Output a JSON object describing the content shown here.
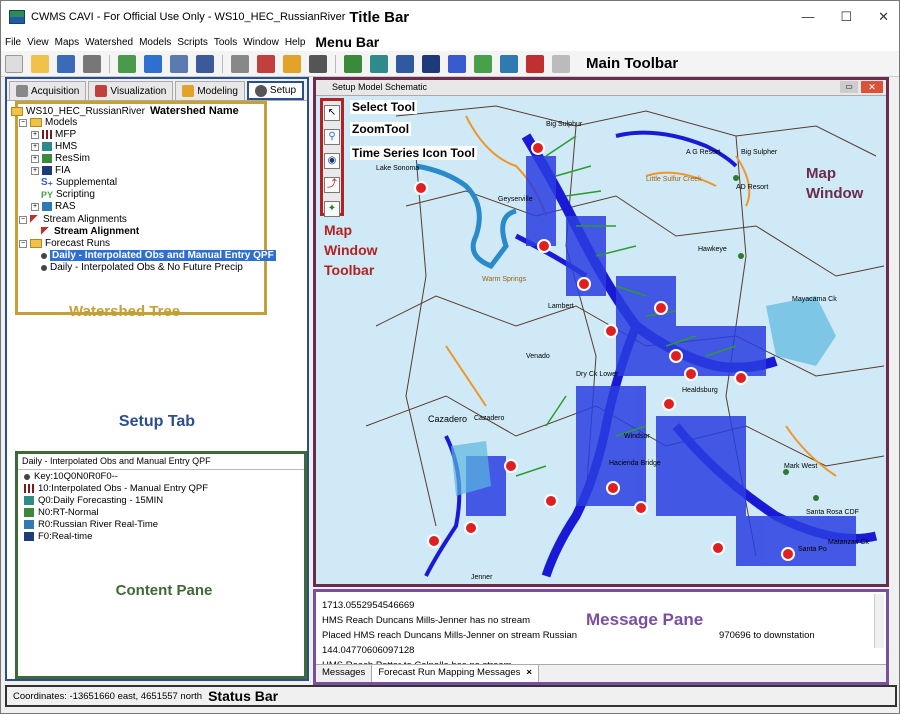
{
  "titlebar": {
    "title": "CWMS CAVI - For Official Use Only  - WS10_HEC_RussianRiver",
    "callout": "Title Bar",
    "minimize": "—",
    "maximize": "☐",
    "close": "✕"
  },
  "menubar": {
    "items": [
      "File",
      "View",
      "Maps",
      "Watershed",
      "Models",
      "Scripts",
      "Tools",
      "Window",
      "Help"
    ],
    "callout": "Menu Bar"
  },
  "toolbar": {
    "callout": "Main Toolbar"
  },
  "tabs": [
    "Acquisition",
    "Visualization",
    "Modeling",
    "Setup"
  ],
  "tree": {
    "watershed": "WS10_HEC_RussianRiver",
    "watershed_callout": "Watershed Name",
    "models": "Models",
    "model_items": [
      "MFP",
      "HMS",
      "ResSim",
      "FIA",
      "Supplemental",
      "Scripting",
      "RAS"
    ],
    "stream_alignments": "Stream Alignments",
    "stream_alignment": "Stream Alignment",
    "forecast_runs": "Forecast Runs",
    "runs": [
      "Daily - Interpolated Obs and Manual Entry QPF",
      "Daily - Interpolated Obs & No Future Precip"
    ],
    "callout": "Watershed Tree"
  },
  "setup_callout": "Setup Tab",
  "content": {
    "header": "Daily - Interpolated Obs and Manual Entry QPF",
    "lines": [
      "Key:10Q0N0R0F0--",
      "10:Interpolated Obs - Manual Entry QPF",
      "Q0:Daily Forecasting - 15MIN",
      "N0:RT-Normal",
      "R0:Russian River Real-Time",
      "F0:Real-time"
    ],
    "callout": "Content Pane"
  },
  "map": {
    "title": "Setup Model Schematic",
    "close": "✕",
    "callouts": {
      "select": "Select Tool",
      "zoom": "ZoomTool",
      "ts": "Time Series Icon Tool",
      "toolbar1": "Map",
      "toolbar2": "Window",
      "toolbar3": "Toolbar",
      "win1": "Map",
      "win2": "Window"
    },
    "places": {
      "bigsulphur": "Big Sulphur",
      "agresort": "A G Resort",
      "bigsulpher2": "Big Sulpher",
      "adresort": "AD Resort",
      "little": "Little Sulfur Creek",
      "geyserville": "Geyserville",
      "hawkeye": "Hawkeye",
      "mayacama": "Mayacama Ck",
      "lambert": "Lambert",
      "warmsprings": "Warm Springs",
      "venado": "Venado",
      "drycklower": "Dry Ck Lower",
      "healdsburg": "Healdsburg",
      "cazadero1": "Cazadero",
      "cazadero2": "Cazadero",
      "windsor": "Windsor",
      "hacienda": "Hacienda Bridge",
      "markwest": "Mark West",
      "santarosa": "Santa Rosa CDF",
      "matanzas": "Matanzas Ck",
      "santapo": "Santa Po",
      "jenner": "Jenner",
      "lakesonoma": "Lake Sonoma"
    }
  },
  "messages": {
    "lines": [
      "1713.0552954546669",
      "HMS Reach Duncans Mills-Jenner has no stream",
      "Placed HMS reach Duncans Mills-Jenner on stream Russian",
      "144.04770606097128",
      "HMS Reach Potter to Calpella has no stream"
    ],
    "line3_tail": "970696 to downstation",
    "callout": "Message Pane",
    "tabs": [
      "Messages",
      "Forecast Run Mapping Messages"
    ],
    "tab_close": "×"
  },
  "status": {
    "coords": "Coordinates: -13651660 east, 4651557 north",
    "callout": "Status Bar"
  },
  "colors": {
    "land": "#cfeaf6",
    "river": "#1a1ad6",
    "stream_green": "#2e9a2e",
    "basin_line": "#5a3a2a",
    "orange_river": "#f0952a"
  }
}
